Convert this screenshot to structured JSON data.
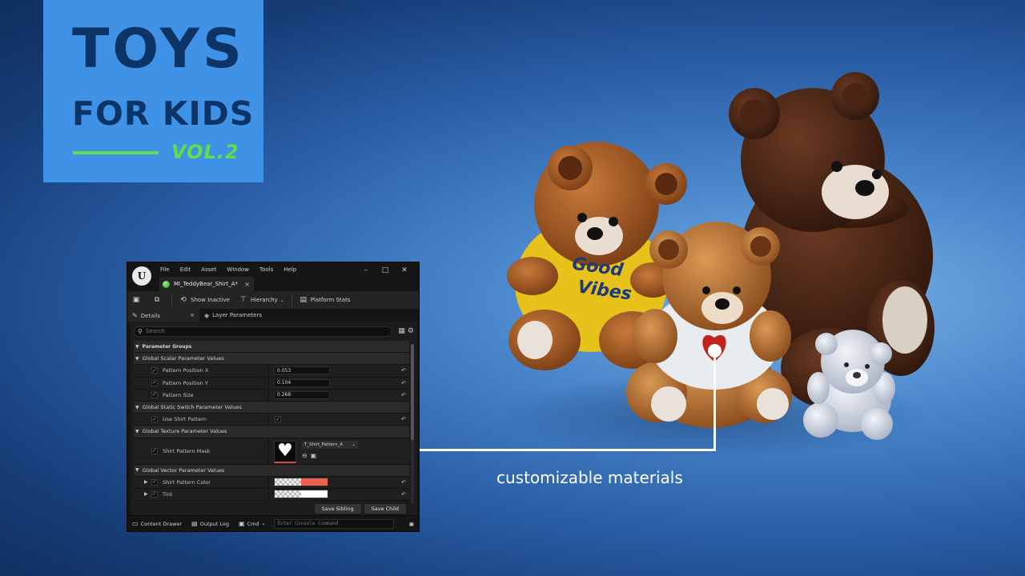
{
  "brand": {
    "title_line1": "TOYS",
    "title_line2": "FOR KIDS",
    "volume": "VOL.2",
    "accent_color": "#5fe04a",
    "card_color": "#3f92e6",
    "text_color": "#0d3466"
  },
  "callout": {
    "text": "customizable materials"
  },
  "scene": {
    "shirt_text": "Good Vibes"
  },
  "editor": {
    "logo_icon": "unreal-engine-logo",
    "menu": [
      "File",
      "Edit",
      "Asset",
      "Window",
      "Tools",
      "Help"
    ],
    "window_controls": [
      "–",
      "□",
      "✕"
    ],
    "asset_tab": {
      "label": "MI_TeddyBear_Shirt_A*",
      "close": "×"
    },
    "toolbar": {
      "show_inactive": "Show Inactive",
      "hierarchy": "Hierarchy",
      "platform_stats": "Platform Stats"
    },
    "panel_tabs": {
      "details": "Details",
      "details_close": "×",
      "layer_parameters": "Layer Parameters"
    },
    "search_placeholder": "Search",
    "groups": {
      "root": "Parameter Groups",
      "scalar": "Global Scalar Parameter Values",
      "static_switch": "Global Static Switch Parameter Values",
      "texture": "Global Texture Parameter Values",
      "vector": "Global Vector Parameter Values"
    },
    "params": {
      "pattern_position_x": {
        "label": "Pattern Position X",
        "value": "0.053"
      },
      "pattern_position_y": {
        "label": "Pattern Position Y",
        "value": "0.104"
      },
      "pattern_size": {
        "label": "Pattern Size",
        "value": "0.268"
      },
      "use_shirt_pattern": {
        "label": "Use Shirt Pattern",
        "checked": true
      },
      "shirt_pattern_mask": {
        "label": "Shirt Pattern Mask",
        "texture": "T_Shirt_Pattern_A"
      },
      "shirt_pattern_color": {
        "label": "Shirt Pattern Color",
        "color": "#f0604f"
      },
      "tint": {
        "label": "Tint",
        "color": "#ffffff"
      }
    },
    "buttons": {
      "save_sibling": "Save Sibling",
      "save_child": "Save Child"
    },
    "status_bar": {
      "content_drawer": "Content Drawer",
      "output_log": "Output Log",
      "cmd": "Cmd",
      "console_placeholder": "Enter Console Command"
    }
  }
}
